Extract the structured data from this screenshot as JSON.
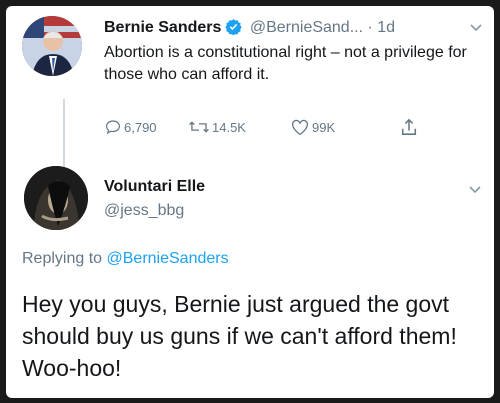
{
  "original_tweet": {
    "author_name": "Bernie Sanders",
    "author_handle": "@BernieSand...",
    "separator": "·",
    "time": "1d",
    "text": "Abortion is a constitutional right – not a privilege for those who can afford it.",
    "replies": "6,790",
    "retweets": "14.5K",
    "likes": "99K"
  },
  "reply_tweet": {
    "author_name": "Voluntari Elle",
    "author_handle": "@jess_bbg",
    "replying_prefix": "Replying to",
    "replying_to": "@BernieSanders",
    "text": "Hey you guys, Bernie just argued the govt should buy us guns if we can't afford them! Woo-hoo!"
  },
  "colors": {
    "text": "#14171a",
    "secondary": "#657786",
    "accent": "#1da1f2",
    "verified": "#1da1f2"
  },
  "icons": [
    "verified-badge-icon",
    "chevron-down-icon",
    "reply-icon",
    "retweet-icon",
    "like-icon",
    "share-icon"
  ]
}
